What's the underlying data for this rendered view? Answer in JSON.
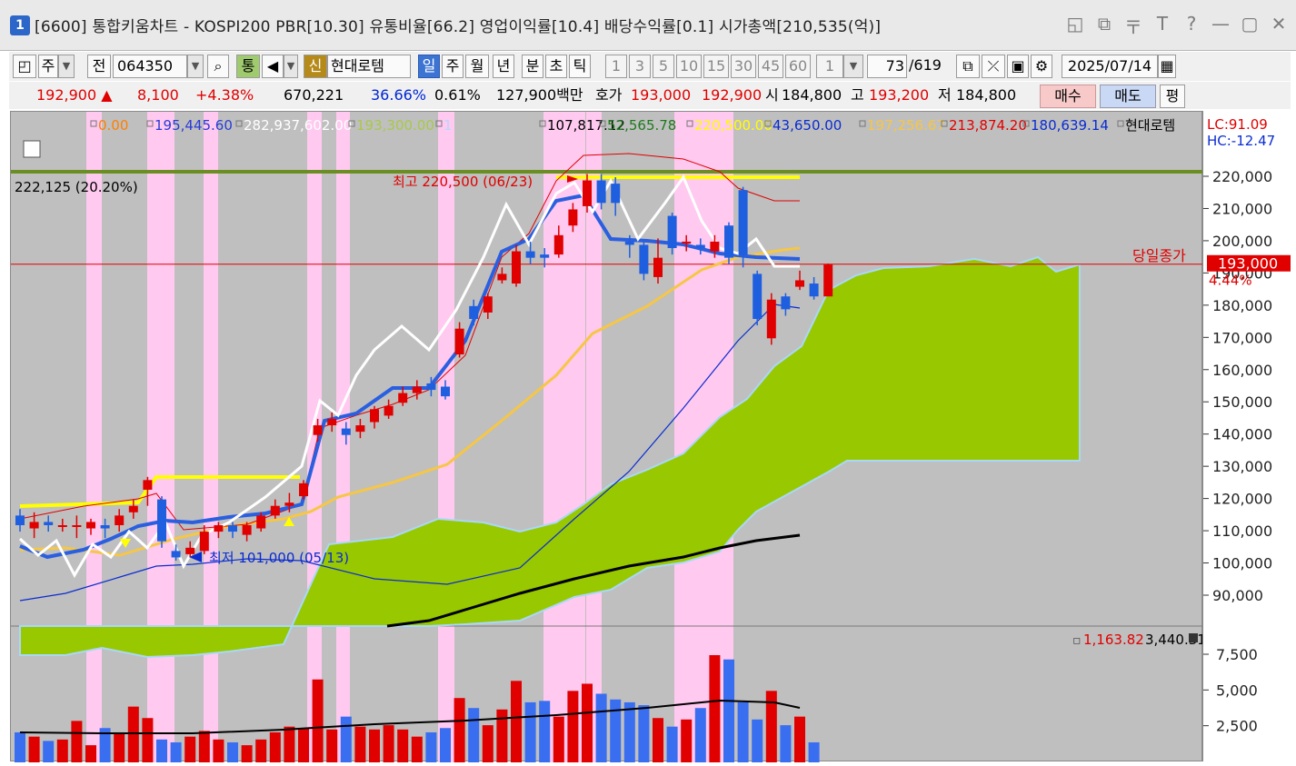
{
  "window": {
    "number": "1",
    "title": "[6600] 통합키움차트 - KOSPI200 PBR[10.30] 유통비율[66.2] 영업이익률[10.4] 배당수익률[0.1] 시가총액[210,535(억)]",
    "controls": [
      "◱",
      "⧉",
      "〒",
      "T",
      "?",
      "—",
      "▢",
      "✕"
    ]
  },
  "toolbar": {
    "period_select": "주",
    "prev_label": "전",
    "code": "064350",
    "tong_label": "통",
    "shin_label": "신",
    "stock_name": "현대로템",
    "period_tabs": [
      "일",
      "주",
      "월",
      "년",
      "분",
      "초",
      "틱"
    ],
    "interval_buttons": [
      "1",
      "3",
      "5",
      "10",
      "15",
      "30",
      "45",
      "60"
    ],
    "interval_value": "1",
    "count_current": "73",
    "count_total": "/619",
    "date": "2025/07/14"
  },
  "quote": {
    "price": "192,900",
    "change": "8,100",
    "change_pct": "+4.38%",
    "volume": "670,221",
    "ratio1": "36.66%",
    "ratio2": "0.61%",
    "amount": "127,900백만",
    "hoga_label": "호가",
    "ask": "193,000",
    "bid": "192,900",
    "open_label": "시",
    "open": "184,800",
    "high_label": "고",
    "high": "193,200",
    "low_label": "저",
    "low": "184,800",
    "buy_label": "매수",
    "sell_label": "매도",
    "pyeong_label": "평"
  },
  "legend": [
    {
      "text": "0.00",
      "color": "#ff7f00"
    },
    {
      "text": "195,445.60",
      "color": "#2a3bd6"
    },
    {
      "text": "282,937,602.00",
      "color": "#ffffff"
    },
    {
      "text": "193,300.00",
      "color": "#a8c94a"
    },
    {
      "text": "1",
      "color": "#b5d8ff"
    },
    {
      "text": "107,817.12",
      "color": "#000000"
    },
    {
      "text": "52,565.78",
      "color": "#1e7a1e"
    },
    {
      "text": "220,500.00",
      "color": "#ffff00"
    },
    {
      "text": "43,650.00",
      "color": "#0a2cd0"
    },
    {
      "text": "197,256.67",
      "color": "#f6c645"
    },
    {
      "text": "213,874.20",
      "color": "#e00000"
    },
    {
      "text": "180,639.14",
      "color": "#0a2cd0"
    },
    {
      "text": "현대로템",
      "color": "#000000"
    }
  ],
  "lc": "LC:91.09",
  "hc": "HC:-12.47",
  "labels": {
    "target": "222,125 (20.20%)",
    "high_mark": "최고 220,500 (06/23)",
    "low_mark": "최저 101,000 (05/13)",
    "close_label": "당일종가",
    "close_value": "193,000",
    "close_pct": "4.44%",
    "vol_legend1": "1,163.82",
    "vol_legend2": "3,440.31"
  },
  "chart_data": {
    "type": "candlestick",
    "price_ticks": [
      220000,
      210000,
      200000,
      190000,
      180000,
      170000,
      160000,
      150000,
      140000,
      130000,
      120000,
      110000,
      100000,
      90000
    ],
    "volume_ticks": [
      "7,500",
      "5,000",
      "2,500"
    ],
    "ylim": [
      85000,
      225000
    ],
    "candles": [
      [
        115000,
        112000,
        117000,
        110000
      ],
      [
        111000,
        113000,
        116000,
        108000
      ],
      [
        113000,
        112000,
        115000,
        110000
      ],
      [
        112000,
        112000,
        114000,
        110000
      ],
      [
        112000,
        112000,
        115000,
        108000
      ],
      [
        111000,
        113000,
        114000,
        109000
      ],
      [
        112000,
        111000,
        114000,
        108000
      ],
      [
        112000,
        115000,
        117000,
        110000
      ],
      [
        116000,
        118000,
        120000,
        114000
      ],
      [
        123000,
        126000,
        127000,
        118000
      ],
      [
        120000,
        107000,
        121000,
        105000
      ],
      [
        104000,
        102000,
        106000,
        101000
      ],
      [
        103000,
        105000,
        107000,
        102000
      ],
      [
        104000,
        110000,
        112000,
        103000
      ],
      [
        110000,
        112000,
        113000,
        108000
      ],
      [
        112000,
        110000,
        113000,
        108000
      ],
      [
        109000,
        112000,
        113000,
        107000
      ],
      [
        111000,
        115000,
        116000,
        110000
      ],
      [
        115000,
        118000,
        120000,
        114000
      ],
      [
        118000,
        119000,
        122000,
        116000
      ],
      [
        121000,
        125000,
        126000,
        120000
      ],
      [
        140000,
        143000,
        145000,
        138000
      ],
      [
        143000,
        145000,
        147000,
        141000
      ],
      [
        142000,
        140000,
        144000,
        137000
      ],
      [
        141000,
        143000,
        145000,
        139000
      ],
      [
        144000,
        148000,
        149000,
        142000
      ],
      [
        146000,
        149000,
        151000,
        145000
      ],
      [
        150000,
        153000,
        155000,
        149000
      ],
      [
        153000,
        155000,
        157000,
        151000
      ],
      [
        156000,
        154000,
        158000,
        152000
      ],
      [
        155000,
        152000,
        157000,
        151000
      ],
      [
        165000,
        173000,
        175000,
        164000
      ],
      [
        180000,
        176000,
        182000,
        174000
      ],
      [
        178000,
        183000,
        184000,
        176000
      ],
      [
        188000,
        190000,
        192000,
        187000
      ],
      [
        187000,
        197000,
        199000,
        186000
      ],
      [
        197000,
        195000,
        200000,
        193000
      ],
      [
        196000,
        195000,
        198000,
        192000
      ],
      [
        196000,
        202000,
        205000,
        195000
      ],
      [
        205000,
        210000,
        212000,
        203000
      ],
      [
        211000,
        219000,
        221000,
        209000
      ],
      [
        219000,
        212000,
        221000,
        210000
      ],
      [
        218000,
        212000,
        220000,
        208000
      ],
      [
        200000,
        199000,
        202000,
        195000
      ],
      [
        199000,
        190000,
        200000,
        188000
      ],
      [
        189000,
        195000,
        201000,
        187000
      ],
      [
        208000,
        198000,
        209000,
        196000
      ],
      [
        200000,
        200000,
        202000,
        197000
      ],
      [
        199000,
        198000,
        201000,
        196000
      ],
      [
        197000,
        200000,
        202000,
        195000
      ],
      [
        205000,
        195000,
        206000,
        193000
      ],
      [
        216000,
        196000,
        217000,
        192000
      ],
      [
        190000,
        176000,
        191000,
        174000
      ],
      [
        170000,
        182000,
        184000,
        168000
      ],
      [
        183000,
        179000,
        184000,
        177000
      ],
      [
        186000,
        188000,
        191000,
        185000
      ],
      [
        187000,
        183000,
        189000,
        182000
      ],
      [
        183000,
        192900,
        193200,
        184800
      ]
    ],
    "volumes": [
      2100,
      1800,
      1500,
      1600,
      2900,
      1200,
      2400,
      2100,
      3900,
      3100,
      1600,
      1400,
      1800,
      2200,
      1600,
      1400,
      1200,
      1600,
      2100,
      2500,
      2400,
      5800,
      2300,
      3200,
      2500,
      2300,
      2600,
      2300,
      1800,
      2100,
      2400,
      4500,
      3800,
      2600,
      3700,
      5700,
      4200,
      4300,
      3200,
      5000,
      5500,
      4800,
      4400,
      4200,
      4000,
      3100,
      2500,
      3000,
      3800,
      7500,
      7200,
      4200,
      3000,
      5000,
      2600,
      3200,
      1400
    ]
  }
}
